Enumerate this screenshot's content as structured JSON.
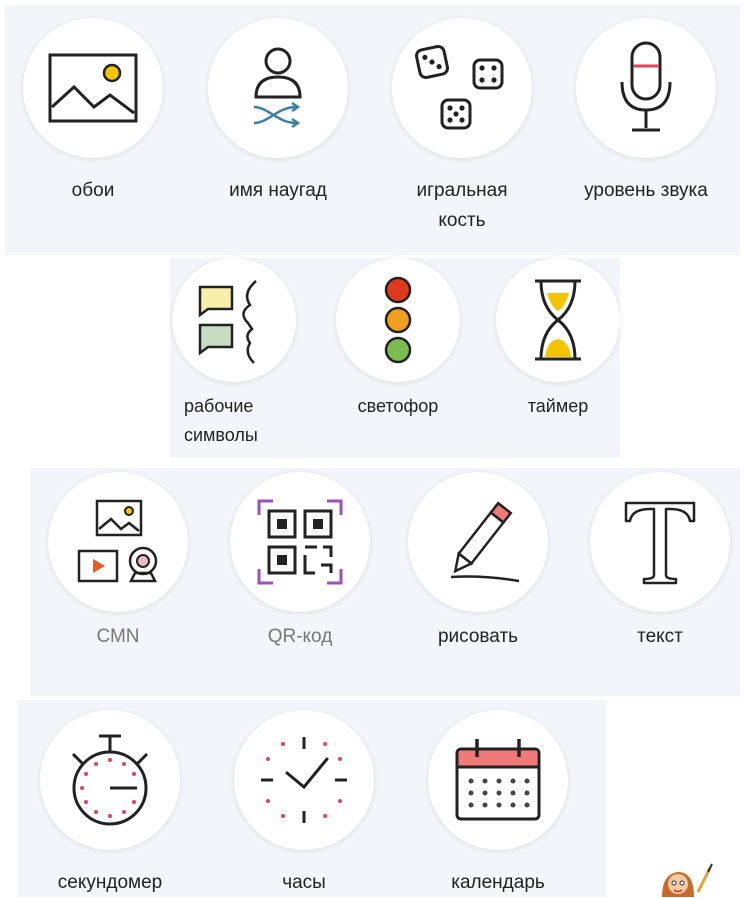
{
  "tools": {
    "wallpaper": {
      "label": "обои",
      "icon": "wallpaper-icon"
    },
    "random_name": {
      "label": "имя наугад",
      "icon": "random-name-icon"
    },
    "dice": {
      "label": "игральная кость",
      "icon": "dice-icon"
    },
    "sound_level": {
      "label": "уровень звука",
      "icon": "microphone-icon"
    },
    "work_symbols": {
      "label": "рабочие символы",
      "icon": "work-symbols-icon"
    },
    "traffic_light": {
      "label": "светофор",
      "icon": "traffic-light-icon"
    },
    "timer": {
      "label": "таймер",
      "icon": "hourglass-icon"
    },
    "media": {
      "label": "СМN",
      "icon": "media-icon"
    },
    "qr_code": {
      "label": "QR-код",
      "icon": "qr-code-icon"
    },
    "draw": {
      "label": "рисовать",
      "icon": "pencil-icon"
    },
    "text": {
      "label": "текст",
      "icon": "text-icon"
    },
    "stopwatch": {
      "label": "секундомер",
      "icon": "stopwatch-icon"
    },
    "clock": {
      "label": "часы",
      "icon": "clock-icon"
    },
    "calendar": {
      "label": "календарь",
      "icon": "calendar-icon"
    }
  },
  "colors": {
    "accent_yellow": "#f5c400",
    "accent_red": "#e0435a",
    "accent_purple": "#9c4fbf",
    "icon_line": "#222222"
  }
}
